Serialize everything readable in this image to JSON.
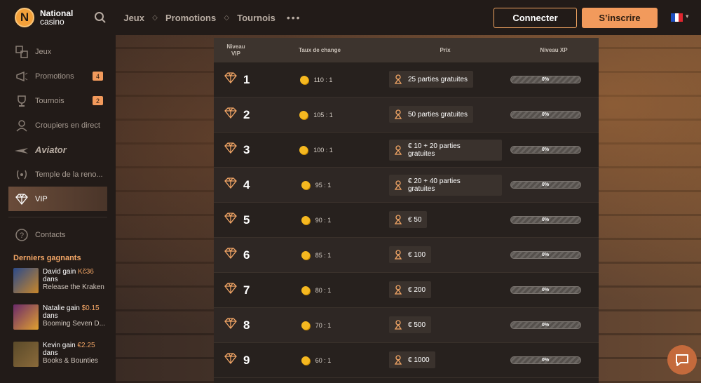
{
  "header": {
    "logo_letter": "N",
    "logo_line1": "National",
    "logo_line2": "casino",
    "nav": [
      "Jeux",
      "Promotions",
      "Tournois"
    ],
    "more": "•••",
    "connect": "Connecter",
    "signup": "S’inscrire",
    "language_flag": [
      "#1f4fbf",
      "#ffffff",
      "#e0262f"
    ]
  },
  "sidebar": {
    "items": [
      {
        "label": "Jeux",
        "icon": "games-icon"
      },
      {
        "label": "Promotions",
        "icon": "megaphone-icon",
        "badge": "4"
      },
      {
        "label": "Tournois",
        "icon": "trophy-icon",
        "badge": "2"
      },
      {
        "label": "Croupiers en direct",
        "icon": "dealer-icon"
      },
      {
        "label": "Aviator",
        "icon": "plane-icon"
      },
      {
        "label": "Temple de la reno...",
        "icon": "laurel-icon"
      },
      {
        "label": "VIP",
        "icon": "diamond-icon"
      }
    ],
    "contacts": "Contacts",
    "winners_title": "Derniers gagnants",
    "winners": [
      {
        "name": "David gain ",
        "amount": "Kč36",
        "dans": "dans",
        "game": "Release the Kraken",
        "thumb": "#2b4a8a"
      },
      {
        "name": "Natalie gain ",
        "amount": "$0.15",
        "dans": "dans",
        "game": "Booming Seven D...",
        "thumb": "#6b2a6a"
      },
      {
        "name": "Kevin gain ",
        "amount": "€2.25",
        "dans": "dans",
        "game": "Books & Bounties",
        "thumb": "#5a4a2a"
      }
    ]
  },
  "table": {
    "headers": {
      "level_line1": "Niveau",
      "level_line2": "VIP",
      "rate": "Taux de change",
      "prize": "Prix",
      "xp": "Niveau XP"
    },
    "rows": [
      {
        "level": "1",
        "rate": "110 : 1",
        "prize_line1": "25 parties gratuites",
        "prize_line2": "",
        "xp": "0%"
      },
      {
        "level": "2",
        "rate": "105 : 1",
        "prize_line1": "50 parties gratuites",
        "prize_line2": "",
        "xp": "0%"
      },
      {
        "level": "3",
        "rate": "100 : 1",
        "prize_line1": "€ 10 + 20 parties",
        "prize_line2": "gratuites",
        "xp": "0%"
      },
      {
        "level": "4",
        "rate": "95 : 1",
        "prize_line1": "€ 20 + 40 parties",
        "prize_line2": "gratuites",
        "xp": "0%"
      },
      {
        "level": "5",
        "rate": "90 : 1",
        "prize_line1": "€ 50",
        "prize_line2": "",
        "xp": "0%"
      },
      {
        "level": "6",
        "rate": "85 : 1",
        "prize_line1": "€ 100",
        "prize_line2": "",
        "xp": "0%"
      },
      {
        "level": "7",
        "rate": "80 : 1",
        "prize_line1": "€ 200",
        "prize_line2": "",
        "xp": "0%"
      },
      {
        "level": "8",
        "rate": "70 : 1",
        "prize_line1": "€ 500",
        "prize_line2": "",
        "xp": "0%"
      },
      {
        "level": "9",
        "rate": "60 : 1",
        "prize_line1": "€ 1000",
        "prize_line2": "",
        "xp": "0%"
      }
    ]
  },
  "colors": {
    "accent": "#f29a5c",
    "coin": "#f5b820"
  }
}
